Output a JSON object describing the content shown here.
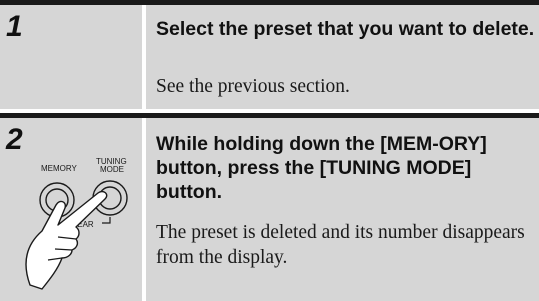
{
  "steps": [
    {
      "number": "1",
      "heading": "Select the preset that you want to delete.",
      "body": "See the previous section."
    },
    {
      "number": "2",
      "heading": "While holding down the [MEM-ORY] button, press the [TUNING MODE] button.",
      "body": "The preset is deleted and its number disappears from the display.",
      "illustration": {
        "memory_label": "MEMORY",
        "tuning_label_line1": "TUNING",
        "tuning_label_line2": "MODE",
        "clear_label": "CLEAR"
      }
    }
  ],
  "colors": {
    "panel": "#d6d6d6",
    "rule": "#1a1a1a"
  }
}
